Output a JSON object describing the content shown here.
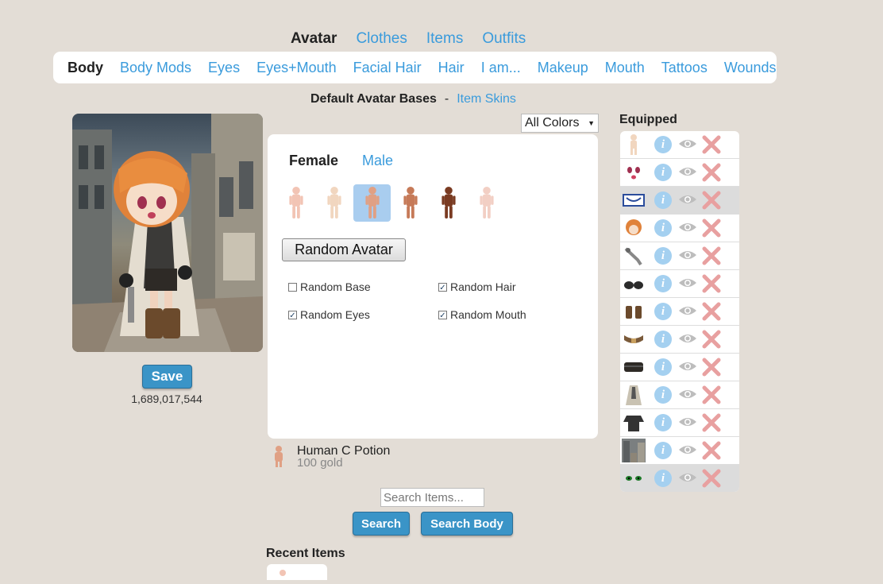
{
  "top_tabs": [
    {
      "label": "Avatar",
      "active": true
    },
    {
      "label": "Clothes",
      "active": false
    },
    {
      "label": "Items",
      "active": false
    },
    {
      "label": "Outfits",
      "active": false
    }
  ],
  "sub_tabs": [
    {
      "label": "Body",
      "active": true
    },
    {
      "label": "Body Mods"
    },
    {
      "label": "Eyes"
    },
    {
      "label": "Eyes+Mouth"
    },
    {
      "label": "Facial Hair"
    },
    {
      "label": "Hair"
    },
    {
      "label": "I am..."
    },
    {
      "label": "Makeup"
    },
    {
      "label": "Mouth"
    },
    {
      "label": "Tattoos"
    },
    {
      "label": "Wounds"
    }
  ],
  "bases": {
    "title": "Default Avatar Bases",
    "separator": "-",
    "link": "Item Skins"
  },
  "save_label": "Save",
  "gold_amount": "1,689,017,544",
  "color_filter": {
    "selected": "All Colors"
  },
  "gender_tabs": [
    {
      "label": "Female",
      "active": true
    },
    {
      "label": "Male",
      "active": false
    }
  ],
  "skin_tones": [
    "#f2c4b4",
    "#f1d6bf",
    "#e0a084",
    "#c67a58",
    "#7a3b22",
    "#f2cfc4"
  ],
  "selected_skin_index": 2,
  "random_avatar_label": "Random Avatar",
  "random_options": [
    {
      "label": "Random Base",
      "checked": false
    },
    {
      "label": "Random Hair",
      "checked": true
    },
    {
      "label": "Random Eyes",
      "checked": true
    },
    {
      "label": "Random Mouth",
      "checked": true
    }
  ],
  "potion": {
    "name": "Human C Potion",
    "price": "100 gold"
  },
  "search": {
    "placeholder": "Search Items...",
    "button": "Search",
    "body_button": "Search Body"
  },
  "recent_title": "Recent Items",
  "equipped_title": "Equipped",
  "equipped_items": [
    {
      "icon": "body-base-icon",
      "shaded": false
    },
    {
      "icon": "face-mouth-icon",
      "shaded": false
    },
    {
      "icon": "frame-item-icon",
      "shaded": true
    },
    {
      "icon": "orange-hair-icon",
      "shaded": false
    },
    {
      "icon": "revolver-icon",
      "shaded": false
    },
    {
      "icon": "gloves-icon",
      "shaded": false
    },
    {
      "icon": "boots-icon",
      "shaded": false
    },
    {
      "icon": "belt-icon",
      "shaded": false
    },
    {
      "icon": "shorts-icon",
      "shaded": false
    },
    {
      "icon": "coat-icon",
      "shaded": false
    },
    {
      "icon": "shirt-icon",
      "shaded": false
    },
    {
      "icon": "city-background-icon",
      "shaded": false
    },
    {
      "icon": "green-eyes-icon",
      "shaded": true
    }
  ],
  "colors": {
    "link": "#3a9bdc",
    "button": "#3a94c7",
    "info": "#a4d0f0",
    "remove": "#e8a0a0"
  }
}
